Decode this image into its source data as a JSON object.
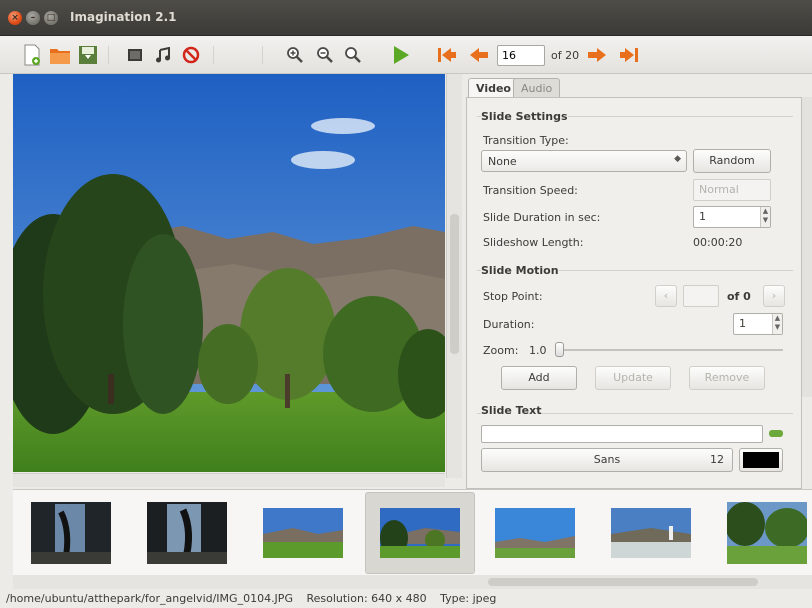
{
  "window": {
    "title": "Imagination 2.1",
    "close_glyph": "×",
    "minimize_glyph": "–",
    "maximize_glyph": "□"
  },
  "toolbar": {
    "icons": [
      "new-project-icon",
      "open-project-icon",
      "save-project-icon",
      "add-slide-icon",
      "add-music-icon",
      "remove-slide-icon",
      "zoom-in-icon",
      "zoom-out-icon",
      "zoom-fit-icon",
      "play-icon",
      "first-slide-icon",
      "previous-slide-icon",
      "next-slide-icon",
      "last-slide-icon"
    ],
    "current_slide": "16",
    "total_label": "of 20"
  },
  "tabs": {
    "video": "Video",
    "audio": "Audio"
  },
  "slide_settings": {
    "title": "Slide Settings",
    "transition_type_label": "Transition Type:",
    "transition_type_value": "None",
    "random_button": "Random",
    "transition_speed_label": "Transition Speed:",
    "transition_speed_value": "Normal",
    "duration_label": "Slide Duration in sec:",
    "duration_value": "1",
    "length_label": "Slideshow Length:",
    "length_value": "00:00:20"
  },
  "slide_motion": {
    "title": "Slide Motion",
    "stop_point_label": "Stop Point:",
    "stop_point_of": "of 0",
    "duration_label": "Duration:",
    "duration_value": "1",
    "zoom_label": "Zoom:",
    "zoom_value": "1.0",
    "add_button": "Add",
    "update_button": "Update",
    "remove_button": "Remove"
  },
  "slide_text": {
    "title": "Slide Text",
    "font_name": "Sans",
    "font_size": "12",
    "text_color": "#000000"
  },
  "statusbar": {
    "path": "/home/ubuntu/atthepark/for_angelvid/IMG_0104.JPG",
    "resolution": "Resolution: 640 x 480",
    "type": "Type: jpeg"
  },
  "colors": {
    "accent_orange": "#e8701c",
    "play_green": "#5ba825",
    "title_bar": "#3b3a36"
  }
}
